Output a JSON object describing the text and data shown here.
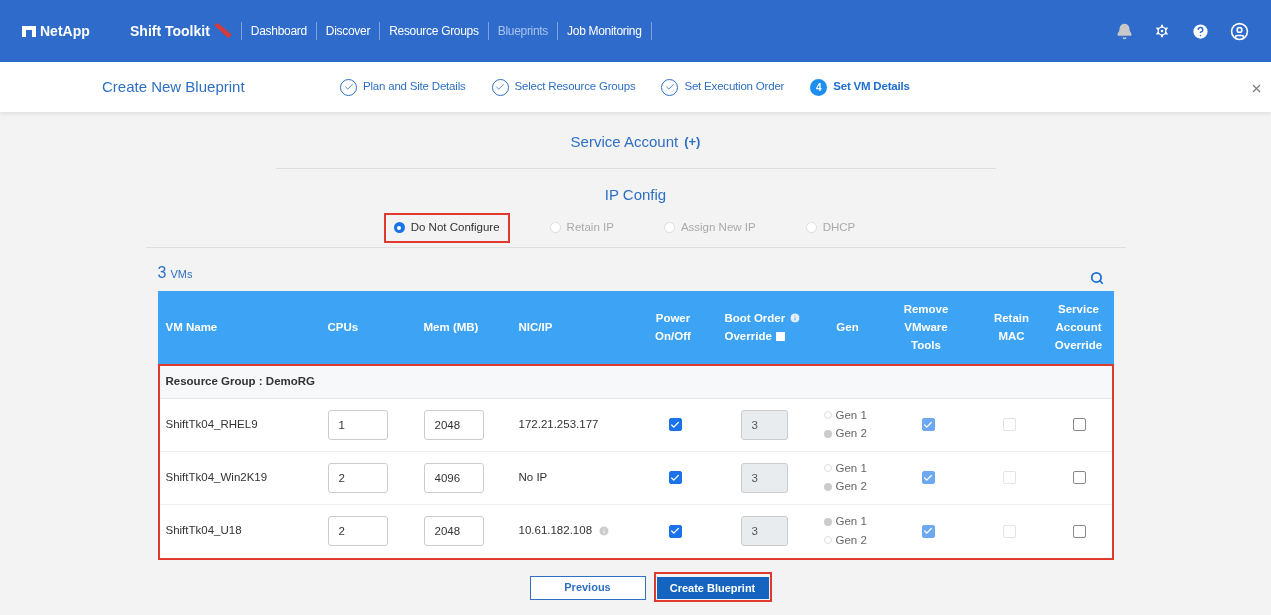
{
  "navbar": {
    "brand": "NetApp",
    "product": "Shift Toolkit",
    "links": [
      {
        "label": "Dashboard",
        "selected": false
      },
      {
        "label": "Discover",
        "selected": false
      },
      {
        "label": "Resource Groups",
        "selected": false
      },
      {
        "label": "Blueprints",
        "selected": true
      },
      {
        "label": "Job Monitoring",
        "selected": false
      }
    ]
  },
  "wizard": {
    "title": "Create New Blueprint",
    "steps": [
      {
        "label": "Plan and Site Details",
        "done": true,
        "selected": false
      },
      {
        "label": "Select Resource Groups",
        "done": true,
        "selected": false
      },
      {
        "label": "Set Execution Order",
        "done": true,
        "selected": false
      },
      {
        "label": "Set VM Details",
        "done": false,
        "selected": true,
        "number": "4"
      }
    ]
  },
  "service_account": {
    "label": "Service Account",
    "add": "(+)"
  },
  "ip_config": {
    "title": "IP Config",
    "options": [
      {
        "label": "Do Not Configure",
        "selected": true,
        "highlighted": true
      },
      {
        "label": "Retain IP",
        "selected": false,
        "highlighted": false
      },
      {
        "label": "Assign New IP",
        "selected": false,
        "highlighted": false
      },
      {
        "label": "DHCP",
        "selected": false,
        "highlighted": false
      }
    ]
  },
  "vm_count": {
    "number": "3",
    "unit": "VMs"
  },
  "table": {
    "columns": [
      "VM Name",
      "CPUs",
      "Mem (MB)",
      "NIC/IP",
      "Power On/Off",
      "Boot Order",
      "Gen",
      "Remove VMware Tools",
      "Retain MAC",
      "Service Account Override"
    ],
    "boot_override_label": "Override",
    "boot_override_checked": false,
    "group": "Resource Group : DemoRG",
    "rows": [
      {
        "name": "ShiftTk04_RHEL9",
        "cpus": "1",
        "mem": "2048",
        "nic": "172.21.253.177",
        "nic_info": false,
        "power": true,
        "boot_order": "3",
        "gens": [
          {
            "label": "Gen 1",
            "selected": false
          },
          {
            "label": "Gen 2",
            "selected": true
          }
        ],
        "remove_tools": true,
        "retain_mac": false,
        "service_override": false
      },
      {
        "name": "ShiftTk04_Win2K19",
        "cpus": "2",
        "mem": "4096",
        "nic": "No IP",
        "nic_info": false,
        "power": true,
        "boot_order": "3",
        "gens": [
          {
            "label": "Gen 1",
            "selected": false
          },
          {
            "label": "Gen 2",
            "selected": true
          }
        ],
        "remove_tools": true,
        "retain_mac": false,
        "service_override": false
      },
      {
        "name": "ShiftTk04_U18",
        "cpus": "2",
        "mem": "2048",
        "nic": "10.61.182.108",
        "nic_info": true,
        "power": true,
        "boot_order": "3",
        "gens": [
          {
            "label": "Gen 1",
            "selected": true
          },
          {
            "label": "Gen 2",
            "selected": false
          }
        ],
        "remove_tools": true,
        "retain_mac": false,
        "service_override": false
      }
    ]
  },
  "buttons": [
    {
      "label": "Previous",
      "kind": "secondary"
    },
    {
      "label": "Create Blueprint",
      "kind": "primary"
    }
  ]
}
